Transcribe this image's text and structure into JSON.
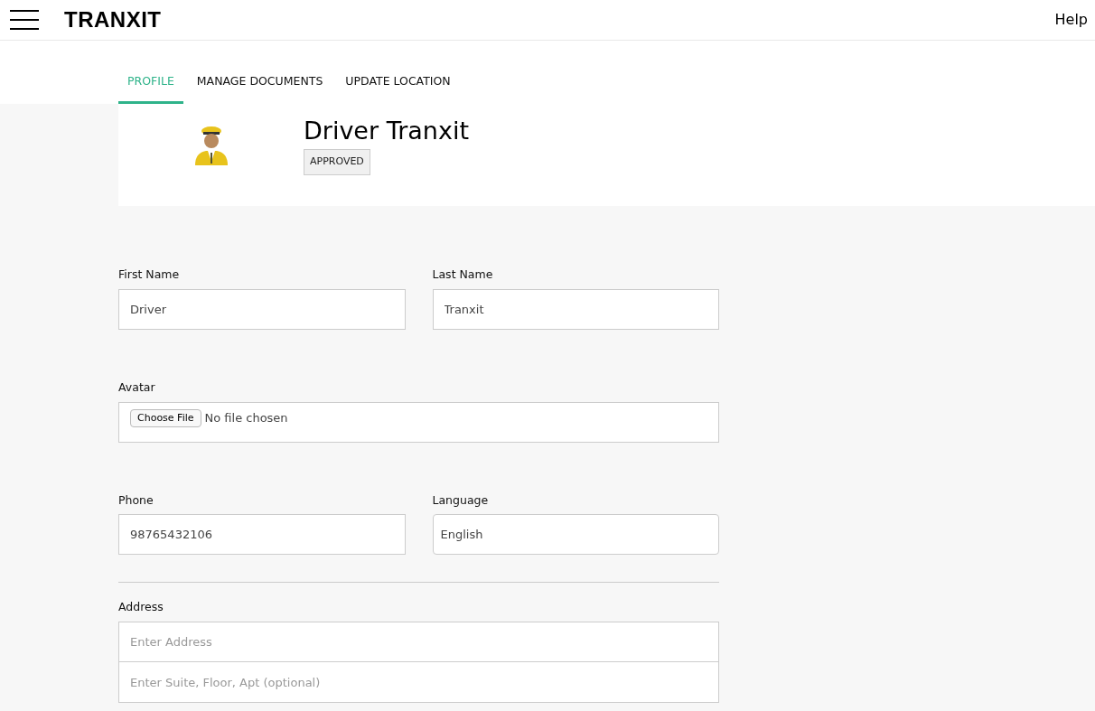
{
  "header": {
    "brand": "TRANXIT",
    "help_link": "Help"
  },
  "tabs": [
    {
      "label": "PROFILE",
      "selected": true
    },
    {
      "label": "MANAGE DOCUMENTS",
      "selected": false
    },
    {
      "label": "UPDATE LOCATION",
      "selected": false
    }
  ],
  "profile": {
    "name": "Driver Tranxit",
    "status": "APPROVED"
  },
  "form": {
    "first_name": {
      "label": "First Name",
      "value": "Driver"
    },
    "last_name": {
      "label": "Last Name",
      "value": "Tranxit"
    },
    "avatar": {
      "label": "Avatar",
      "button": "Choose File",
      "file_status": "No file chosen"
    },
    "phone": {
      "label": "Phone",
      "value": "98765432106"
    },
    "language": {
      "label": "Language",
      "value": "English"
    },
    "address": {
      "label": "Address",
      "fields": [
        {
          "placeholder": "Enter Address"
        },
        {
          "placeholder": "Enter Suite, Floor, Apt (optional)"
        }
      ]
    }
  }
}
